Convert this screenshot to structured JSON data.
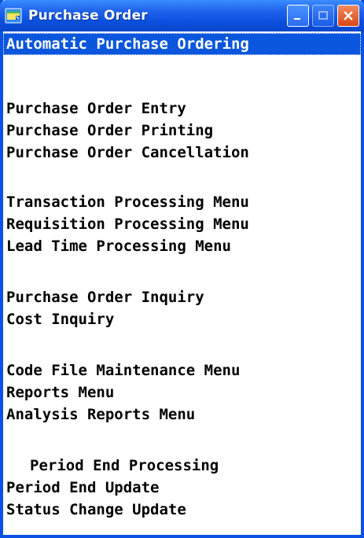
{
  "window": {
    "title": "Purchase Order",
    "icon": "app-window-icon"
  },
  "title_controls": [
    {
      "name": "minimize",
      "icon": "minimize-icon"
    },
    {
      "name": "maximize",
      "icon": "maximize-icon"
    },
    {
      "name": "close",
      "icon": "close-icon"
    }
  ],
  "menu": {
    "items": [
      {
        "label": "Automatic Purchase Ordering",
        "selected": true
      },
      {
        "label": "Purchase Order Entry"
      },
      {
        "label": "Purchase Order Printing"
      },
      {
        "label": "Purchase Order Cancellation"
      },
      {
        "label": "Transaction Processing Menu"
      },
      {
        "label": "Requisition Processing Menu"
      },
      {
        "label": "Lead Time Processing Menu"
      },
      {
        "label": "Purchase Order Inquiry"
      },
      {
        "label": "Cost Inquiry"
      },
      {
        "label": "Code File Maintenance Menu"
      },
      {
        "label": "Reports Menu"
      },
      {
        "label": "Analysis Reports Menu"
      },
      {
        "label": "Period End Processing",
        "header": true
      },
      {
        "label": "Period End Update"
      },
      {
        "label": "Status Change Update"
      }
    ]
  },
  "colors": {
    "titlebar": "#0a52e6",
    "selection": "#0a56dd",
    "text": "#000000",
    "close_button": "#d84715"
  }
}
